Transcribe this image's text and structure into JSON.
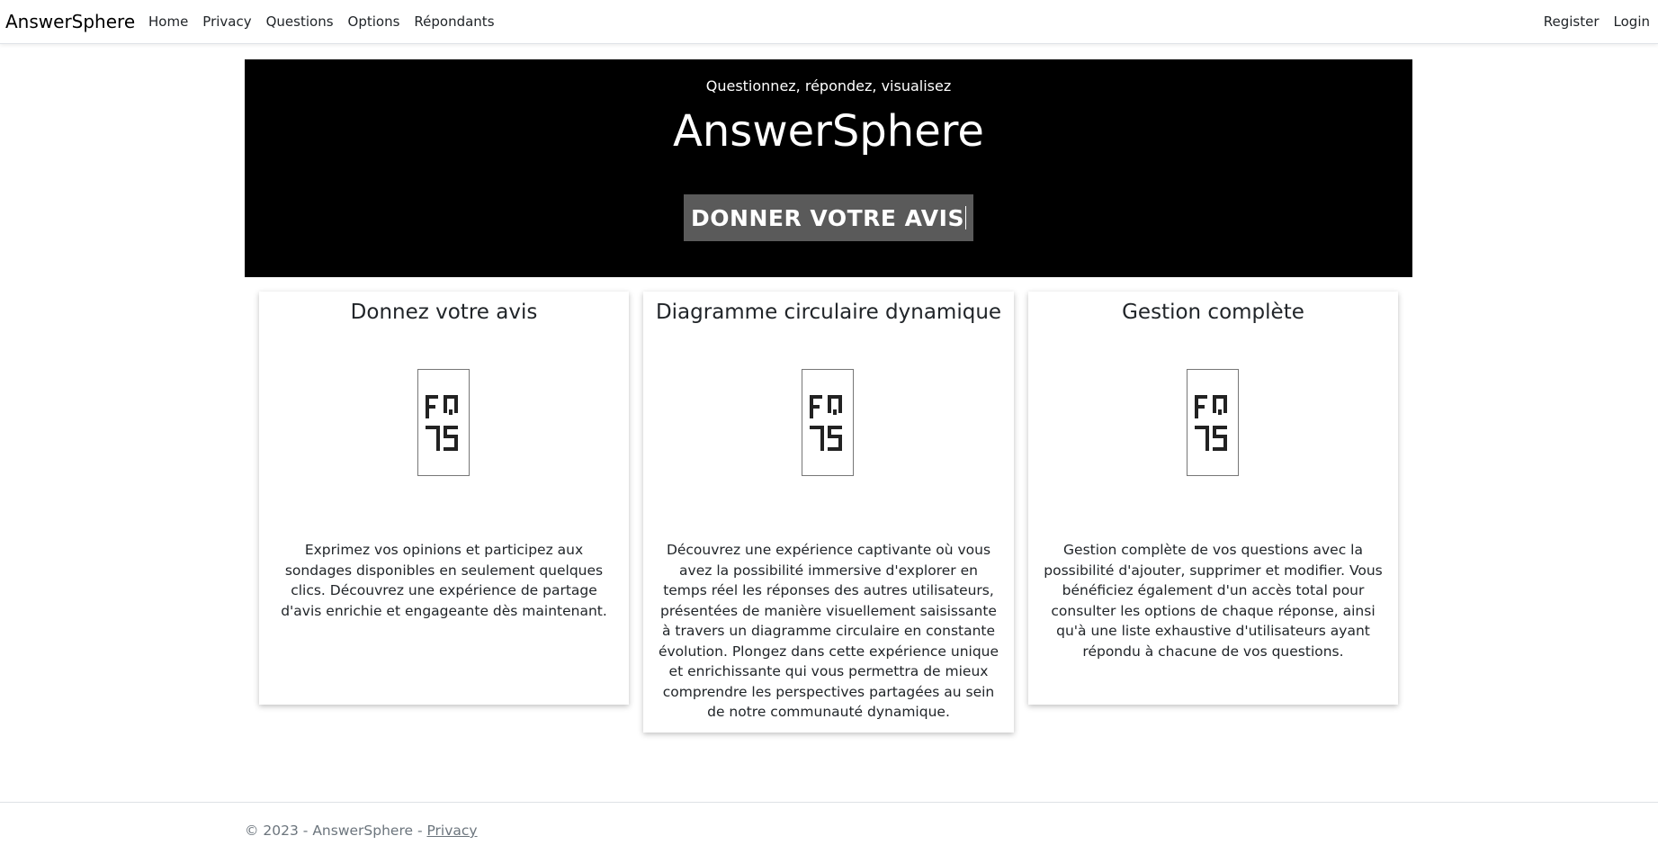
{
  "navbar": {
    "brand": "AnswerSphere",
    "left_items": [
      "Home",
      "Privacy",
      "Questions",
      "Options",
      "Répondants"
    ],
    "right_items": [
      "Register",
      "Login"
    ]
  },
  "hero": {
    "subtitle": "Questionnez, répondez, visualisez",
    "title": "AnswerSphere",
    "cta_label": "DONNER VOTRE AVIS"
  },
  "cards": [
    {
      "title": "Donnez votre avis",
      "image_icon": "broken-image-icon",
      "text": "Exprimez vos opinions et participez aux sondages disponibles en seulement quelques clics. Découvrez une expérience de partage d'avis enrichie et engageante dès maintenant."
    },
    {
      "title": "Diagramme circulaire dynamique",
      "image_icon": "broken-image-icon",
      "text": "Découvrez une expérience captivante où vous avez la possibilité immersive d'explorer en temps réel les réponses des autres utilisateurs, présentées de manière visuellement saisissante à travers un diagramme circulaire en constante évolution. Plongez dans cette expérience unique et enrichissante qui vous permettra de mieux comprendre les perspectives partagées au sein de notre communauté dynamique."
    },
    {
      "title": "Gestion complète",
      "image_icon": "broken-image-icon",
      "text": "Gestion complète de vos questions avec la possibilité d'ajouter, supprimer et modifier. Vous bénéficiez également d'un accès total pour consulter les options de chaque réponse, ainsi qu'à une liste exhaustive d'utilisateurs ayant répondu à chacune de vos questions."
    }
  ],
  "footer": {
    "copyright": "© 2023 - AnswerSphere - ",
    "privacy_link": "Privacy"
  },
  "colors": {
    "hero_bg": "#000000",
    "cta_bg": "#5a5a5a",
    "footer_text": "#6c757d"
  }
}
